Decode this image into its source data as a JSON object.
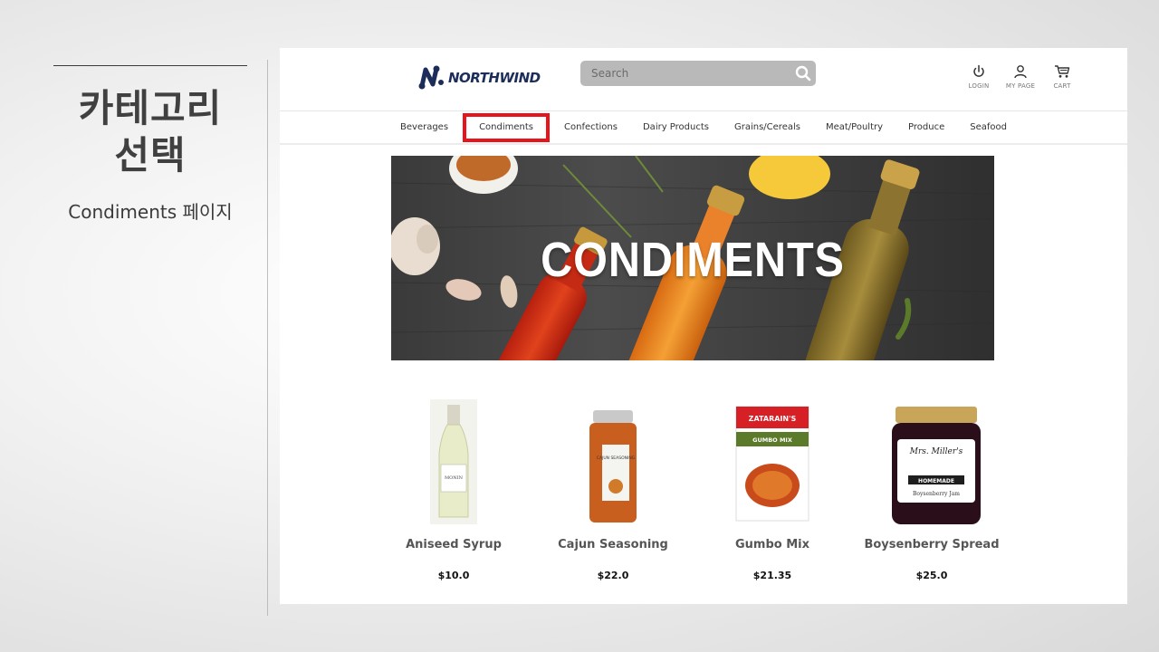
{
  "slide": {
    "title_line1": "카테고리",
    "title_line2": "선택",
    "subtitle": "Condiments 페이지"
  },
  "header": {
    "logo_text": "NORTHWIND",
    "search_placeholder": "Search",
    "icons": [
      {
        "icon": "power-icon",
        "label": "LOGIN"
      },
      {
        "icon": "user-icon",
        "label": "MY PAGE"
      },
      {
        "icon": "cart-icon",
        "label": "CART"
      }
    ]
  },
  "nav": {
    "items": [
      "Beverages",
      "Condiments",
      "Confections",
      "Dairy Products",
      "Grains/Cereals",
      "Meat/Poultry",
      "Produce",
      "Seafood"
    ],
    "active": "Condiments",
    "highlight_color": "#e8141c"
  },
  "banner": {
    "title": "CONDIMENTS"
  },
  "products": [
    {
      "name": "Aniseed Syrup",
      "price": "$10.0"
    },
    {
      "name": "Cajun Seasoning",
      "price": "$22.0"
    },
    {
      "name": "Gumbo Mix",
      "price": "$21.35"
    },
    {
      "name": "Boysenberry Spread",
      "price": "$25.0"
    }
  ],
  "product_image_text": {
    "syrup_label": "MONIN",
    "cajun_label": "CAJUN SEASONING",
    "gumbo_brand": "ZATARAIN'S",
    "gumbo_label": "GUMBO MIX",
    "jam_brand": "Mrs. Miller's",
    "jam_sub": "HOMEMADE",
    "jam_label": "Boysenberry Jam"
  }
}
